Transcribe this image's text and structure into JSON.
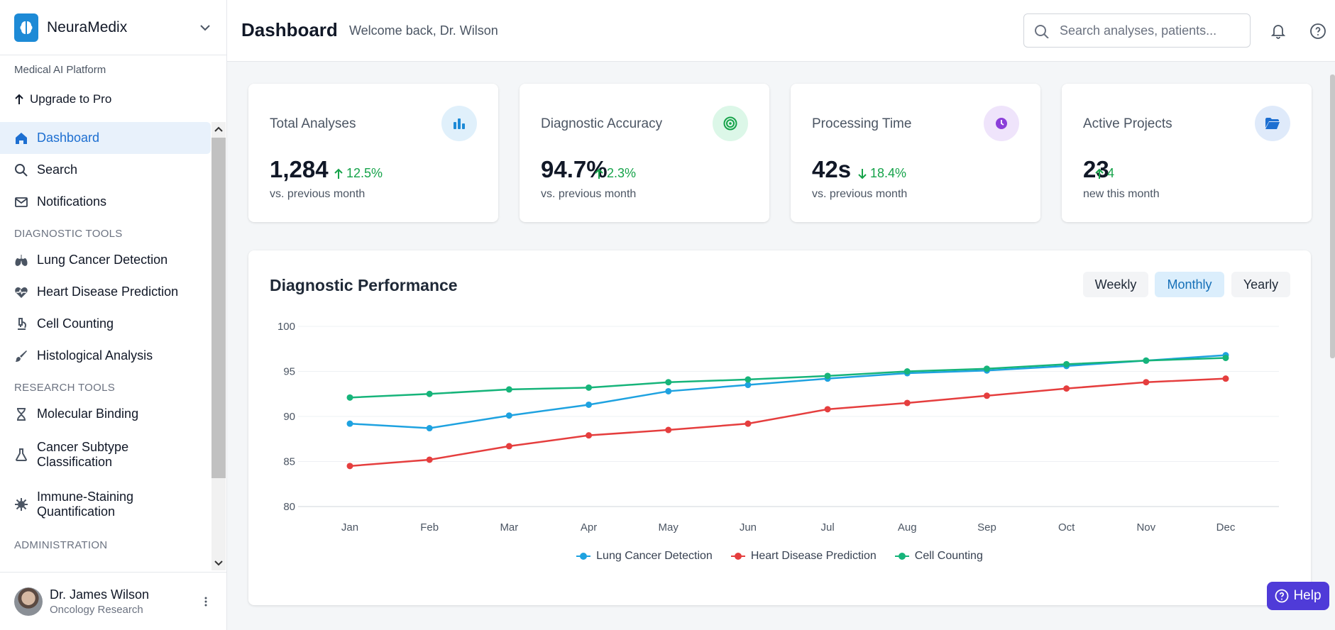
{
  "brand": {
    "name": "NeuraMedix",
    "platform_label": "Medical AI Platform",
    "upgrade_label": "Upgrade to Pro"
  },
  "sidebar": {
    "main_items": [
      {
        "label": "Dashboard",
        "icon": "home-icon",
        "active": true
      },
      {
        "label": "Search",
        "icon": "search-icon"
      },
      {
        "label": "Notifications",
        "icon": "mail-icon"
      }
    ],
    "diagnostic_section": "DIAGNOSTIC TOOLS",
    "diagnostic_items": [
      {
        "label": "Lung Cancer Detection",
        "icon": "lungs-icon"
      },
      {
        "label": "Heart Disease Prediction",
        "icon": "heart-pulse-icon"
      },
      {
        "label": "Cell Counting",
        "icon": "microscope-icon"
      },
      {
        "label": "Histological Analysis",
        "icon": "brush-icon"
      }
    ],
    "research_section": "RESEARCH TOOLS",
    "research_items": [
      {
        "label": "Molecular Binding",
        "icon": "hourglass-icon"
      },
      {
        "label_line1": "Cancer Subtype",
        "label_line2": "Classification",
        "icon": "flask-icon"
      },
      {
        "label_line1": "Immune-Staining",
        "label_line2": "Quantification",
        "icon": "virus-icon"
      }
    ],
    "admin_section": "ADMINISTRATION"
  },
  "user": {
    "name": "Dr. James Wilson",
    "role": "Oncology Research"
  },
  "header": {
    "title": "Dashboard",
    "welcome": "Welcome back, Dr. Wilson",
    "search_placeholder": "Search analyses, patients..."
  },
  "stats": [
    {
      "title": "Total Analyses",
      "value": "1,284",
      "change": "12.5%",
      "direction": "up",
      "sub": "vs. previous month",
      "icon": "bar-chart-icon",
      "icon_color": "#1d8ad6",
      "icon_bg": "#e0f0fb"
    },
    {
      "title": "Diagnostic Accuracy",
      "value": "94.7%",
      "change": "2.3%",
      "direction": "up",
      "sub": "vs. previous month",
      "icon": "target-icon",
      "icon_color": "#16a34a",
      "icon_bg": "#dcf7e8"
    },
    {
      "title": "Processing Time",
      "value": "42s",
      "change": "18.4%",
      "direction": "down",
      "sub": "vs. previous month",
      "icon": "clock-icon",
      "icon_color": "#8b3fd9",
      "icon_bg": "#efe4fb"
    },
    {
      "title": "Active Projects",
      "value": "23",
      "change": "4",
      "direction": "up",
      "sub": "new this month",
      "icon": "folder-open-icon",
      "icon_color": "#1d6fd1",
      "icon_bg": "#dfeafa"
    }
  ],
  "performance": {
    "title": "Diagnostic Performance",
    "ranges": [
      "Weekly",
      "Monthly",
      "Yearly"
    ],
    "active_range": "Monthly"
  },
  "chart_data": {
    "type": "line",
    "categories": [
      "Jan",
      "Feb",
      "Mar",
      "Apr",
      "May",
      "Jun",
      "Jul",
      "Aug",
      "Sep",
      "Oct",
      "Nov",
      "Dec"
    ],
    "ylim": [
      80,
      100
    ],
    "yticks": [
      80,
      85,
      90,
      95,
      100
    ],
    "grid": true,
    "legend": "bottom",
    "series": [
      {
        "name": "Lung Cancer Detection",
        "color": "#1ea2e0",
        "values": [
          89.2,
          88.7,
          90.1,
          91.3,
          92.8,
          93.5,
          94.2,
          94.8,
          95.1,
          95.6,
          96.2,
          96.8
        ]
      },
      {
        "name": "Heart Disease Prediction",
        "color": "#e53e3e",
        "values": [
          84.5,
          85.2,
          86.7,
          87.9,
          88.5,
          89.2,
          90.8,
          91.5,
          92.3,
          93.1,
          93.8,
          94.2
        ]
      },
      {
        "name": "Cell Counting",
        "color": "#16b47a",
        "values": [
          92.1,
          92.5,
          93.0,
          93.2,
          93.8,
          94.1,
          94.5,
          95.0,
          95.3,
          95.8,
          96.2,
          96.5
        ]
      }
    ]
  },
  "help": {
    "label": "Help"
  }
}
